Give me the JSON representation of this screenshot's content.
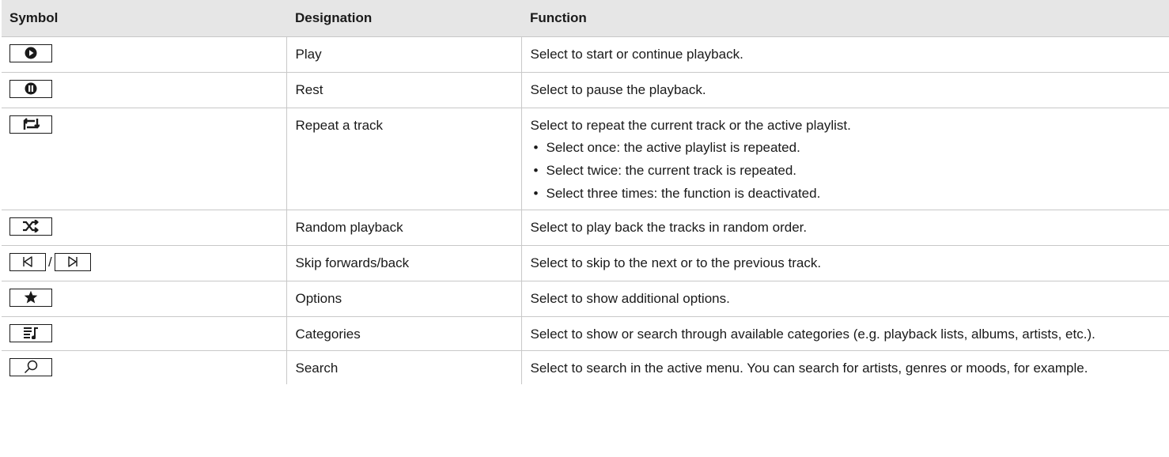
{
  "table": {
    "headers": [
      "Symbol",
      "Designation",
      "Function"
    ],
    "rows": [
      {
        "icon": "play-icon",
        "designation": "Play",
        "function": "Select to start or continue playback."
      },
      {
        "icon": "pause-icon",
        "designation": "Rest",
        "function": "Select to pause the playback."
      },
      {
        "icon": "repeat-icon",
        "designation": "Repeat a track",
        "function": "Select to repeat the current track or the active playlist.",
        "bullets": [
          "Select once: the active playlist is repeated.",
          "Select twice: the current track is repeated.",
          "Select three times: the function is deactivated."
        ]
      },
      {
        "icon": "shuffle-icon",
        "designation": "Random playback",
        "function": "Select to play back the tracks in random order."
      },
      {
        "icon": "skip-back-icon",
        "icon2": "skip-forward-icon",
        "separator": "/",
        "designation": "Skip forwards/back",
        "function": "Select to skip to the next or to the previous track."
      },
      {
        "icon": "star-icon",
        "designation": "Options",
        "function": "Select to show additional options."
      },
      {
        "icon": "playlist-icon",
        "designation": "Categories",
        "function": "Select to show or search through available categories (e.g. playback lists, albums, artists, etc.)."
      },
      {
        "icon": "search-icon",
        "designation": "Search",
        "function": "Select to search in the active menu. You can search for artists, genres or moods, for example."
      }
    ]
  }
}
